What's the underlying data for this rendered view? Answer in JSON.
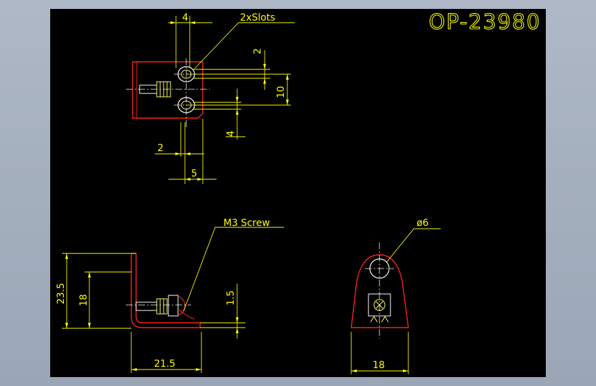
{
  "drawing": {
    "part_number": "OP-23980",
    "colors": {
      "background": "#000000",
      "frame": "#9aa6b6",
      "dimension": "#ffff00",
      "outline": "#ff2020",
      "geometry": "#ffffff",
      "screw": "#ffff66"
    },
    "top_view": {
      "slot_callout": "2xSlots",
      "dims": {
        "slot_width": "4",
        "slot_height": "2",
        "slot_spacing": "10",
        "slot_offset": "4",
        "left_offset": "2",
        "bottom_width": "5"
      }
    },
    "side_view": {
      "screw_callout": "M3 Screw",
      "dims": {
        "height_total": "23.5",
        "height_hole": "18",
        "thickness": "1.5",
        "length": "21.5"
      }
    },
    "front_view": {
      "hole_callout": "ø6",
      "dims": {
        "width": "18"
      }
    }
  }
}
